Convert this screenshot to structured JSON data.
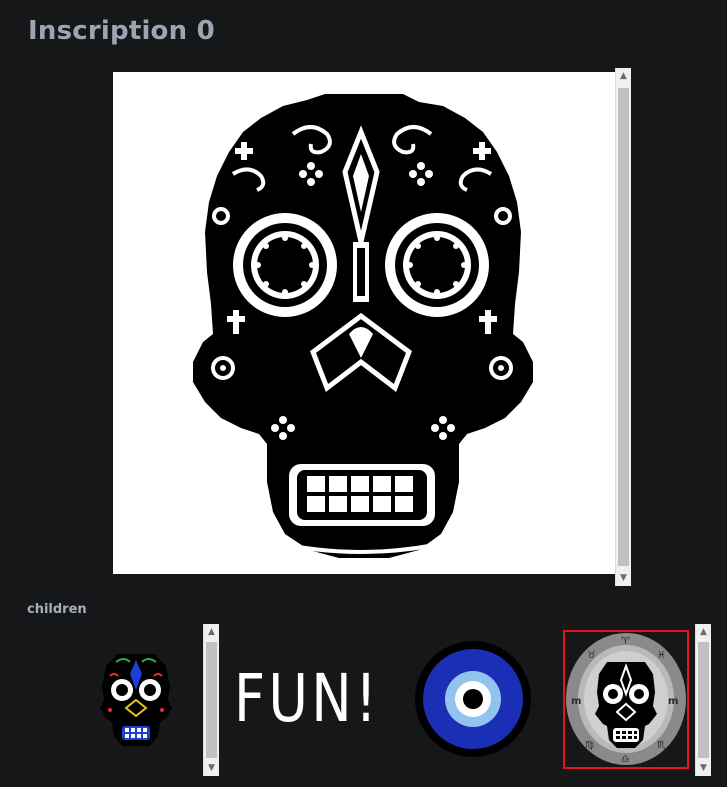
{
  "page": {
    "title": "Inscription 0",
    "children_label": "children"
  },
  "main_preview": {
    "background": "#ffffff",
    "ink": "#000000",
    "icon": "sugar-skull-pixel-art"
  },
  "children": [
    {
      "name": "child-skull-color",
      "icon": "color-sugar-skull",
      "selected": false
    },
    {
      "name": "child-fun-text",
      "text": "FUN!",
      "selected": false
    },
    {
      "name": "child-evil-eye",
      "icon": "evil-eye-icon",
      "colors": {
        "outer": "#000000",
        "ring": "#1a2fb5",
        "iris": "#90c4ef",
        "pupil": "#000000"
      },
      "selected": false
    },
    {
      "name": "child-zodiac-skull",
      "icon": "zodiac-skull",
      "selected": true
    }
  ],
  "colors": {
    "background": "#161719",
    "title": "#9ea4b1",
    "selection": "#e3141c"
  }
}
